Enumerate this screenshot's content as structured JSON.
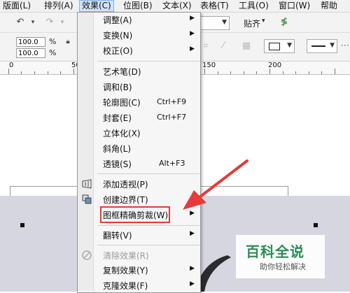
{
  "menubar": {
    "items": [
      {
        "label": "版面(L)"
      },
      {
        "label": "排列(A)"
      },
      {
        "label": "效果(C)"
      },
      {
        "label": "位图(B)"
      },
      {
        "label": "文本(X)"
      },
      {
        "label": "表格(T)"
      },
      {
        "label": "工具(O)"
      },
      {
        "label": "窗口(W)"
      },
      {
        "label": "帮助"
      }
    ]
  },
  "toolbar": {
    "snap_label": "贴齐",
    "scale_x": "100.0",
    "scale_y": "100.0",
    "percent": "%"
  },
  "ruler": {
    "labels": [
      "0",
      "50",
      "150",
      "200"
    ]
  },
  "menu": {
    "items": [
      {
        "label": "调整(A)",
        "submenu": "▶"
      },
      {
        "label": "变换(N)",
        "submenu": "▶"
      },
      {
        "label": "校正(O)",
        "submenu": "▶"
      },
      {
        "label": "艺术笔(D)"
      },
      {
        "label": "调和(B)"
      },
      {
        "label": "轮廓图(C)",
        "shortcut": "Ctrl+F9"
      },
      {
        "label": "封套(E)",
        "shortcut": "Ctrl+F7"
      },
      {
        "label": "立体化(X)"
      },
      {
        "label": "斜角(L)"
      },
      {
        "label": "透镜(S)",
        "shortcut": "Alt+F3"
      },
      {
        "label": "添加透视(P)"
      },
      {
        "label": "创建边界(T)"
      },
      {
        "label": "图框精确剪裁(W)",
        "submenu": "▶"
      },
      {
        "label": "翻转(V)",
        "submenu": "▶"
      },
      {
        "label": "清除效果(R)"
      },
      {
        "label": "复制效果(Y)",
        "submenu": "▶"
      },
      {
        "label": "克隆效果(F)",
        "submenu": "▶"
      }
    ]
  },
  "watermark": {
    "title": "百科全说",
    "subtitle": "助你轻松解决"
  },
  "colors": {
    "highlight_box": "#e53b3b",
    "arrow": "#e53b3b",
    "watermark_green": "#2e8b57",
    "canvas_gray": "#d6d6e1"
  }
}
